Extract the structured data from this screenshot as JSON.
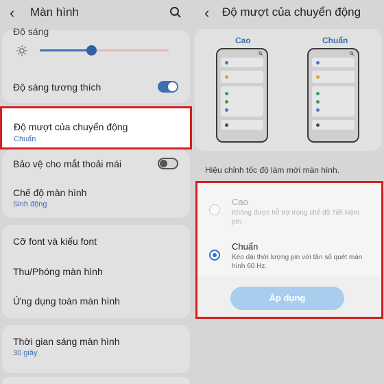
{
  "left": {
    "title": "Màn hình",
    "brightness_label": "Độ sáng",
    "brightness_level": 0.4,
    "adaptive_brightness": {
      "label": "Độ sáng tương thích",
      "on": true
    },
    "motion_smoothness": {
      "label": "Độ mượt của chuyển động",
      "value": "Chuẩn"
    },
    "eye_comfort": {
      "label": "Bảo vệ cho mắt thoải mái",
      "on": false
    },
    "screen_mode": {
      "label": "Chế độ màn hình",
      "value": "Sinh động"
    },
    "font": {
      "label": "Cỡ font và kiểu font"
    },
    "zoom": {
      "label": "Thu/Phóng màn hình"
    },
    "fullscreen_apps": {
      "label": "Ứng dụng toàn màn hình"
    },
    "screen_timeout": {
      "label": "Thời gian sáng màn hình",
      "value": "30 giây"
    }
  },
  "right": {
    "title": "Độ mượt của chuyển động",
    "preview_high": "Cao",
    "preview_standard": "Chuẩn",
    "description": "Hiệu chỉnh tốc độ làm mới màn hình.",
    "option_high": {
      "title": "Cao",
      "desc": "Không được hỗ trợ trong chế độ Tiết kiệm pin."
    },
    "option_standard": {
      "title": "Chuẩn",
      "desc": "Kéo dài thời lượng pin với tần số quét màn hình 60 Hz."
    },
    "apply_label": "Áp dụng"
  },
  "colors": {
    "accent": "#3f6fb0",
    "highlight_border": "#d42020",
    "apply_bg": "#a9cdee"
  },
  "icons": {
    "back": "chevron-left-icon",
    "search": "search-icon",
    "brightness": "sun-icon"
  }
}
